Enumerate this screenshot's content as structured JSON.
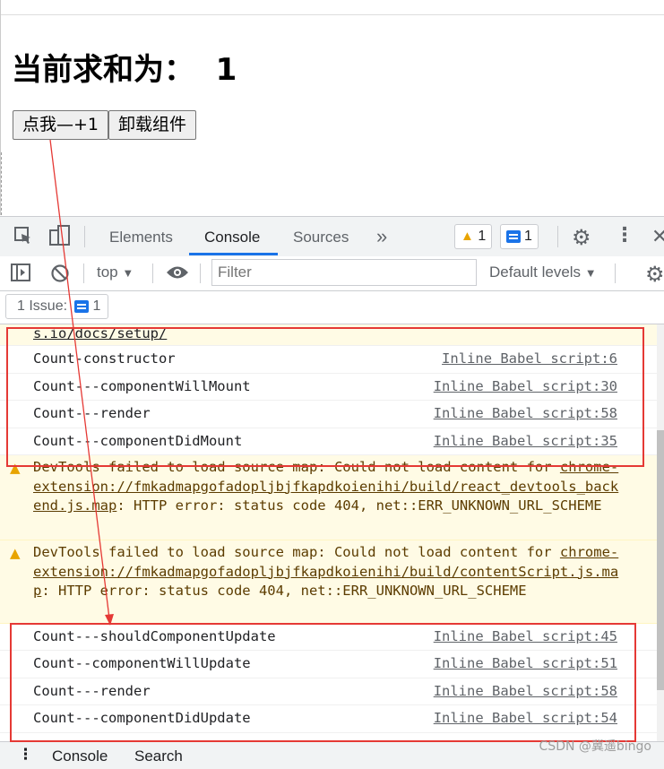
{
  "page": {
    "heading": "当前求和为：  1",
    "increment_button": "点我—+1",
    "unmount_button": "卸载组件"
  },
  "devtools": {
    "tabs": [
      "Elements",
      "Console",
      "Sources"
    ],
    "active_tab": "Console",
    "more_tabs_icon": "»",
    "warning_count": "1",
    "message_count": "1",
    "context": "top",
    "filter_placeholder": "Filter",
    "levels": "Default levels",
    "issues_label": "1 Issue:",
    "issues_count": "1"
  },
  "console": {
    "rows": [
      {
        "message": "s.io/docs/setup/",
        "source": ""
      },
      {
        "message": "Count-constructor",
        "source": "Inline Babel script:6"
      },
      {
        "message": "Count---componentWillMount",
        "source": "Inline Babel script:30"
      },
      {
        "message": "Count---render",
        "source": "Inline Babel script:58"
      },
      {
        "message": "Count---componentDidMount",
        "source": "Inline Babel script:35"
      },
      {
        "message": "Count---shouldComponentUpdate",
        "source": "Inline Babel script:45"
      },
      {
        "message": "Count--componentWillUpdate",
        "source": "Inline Babel script:51"
      },
      {
        "message": "Count---render",
        "source": "Inline Babel script:58"
      },
      {
        "message": "Count---componentDidUpdate",
        "source": "Inline Babel script:54"
      }
    ],
    "warnings": [
      {
        "pre": "DevTools failed to load source map: Could not load content for ",
        "link": "chrome-extension://fmkadmapgofadopljbjfkapdkoienihi/build/react_devtools_backend.js.map",
        "post": ": HTTP error: status code 404, net::ERR_UNKNOWN_URL_SCHEME"
      },
      {
        "pre": "DevTools failed to load source map: Could not load content for ",
        "link": "chrome-extension://fmkadmapgofadopljbjfkapdkoienihi/build/contentScript.js.map",
        "post": ": HTTP error: status code 404, net::ERR_UNKNOWN_URL_SCHEME"
      }
    ]
  },
  "drawer": {
    "tabs": [
      "Console",
      "Search"
    ]
  },
  "watermark": "CSDN @冀遥bingo",
  "colors": {
    "highlight": "#e53935",
    "accent": "#1a73e8",
    "warning_bg": "#fffbe5"
  }
}
